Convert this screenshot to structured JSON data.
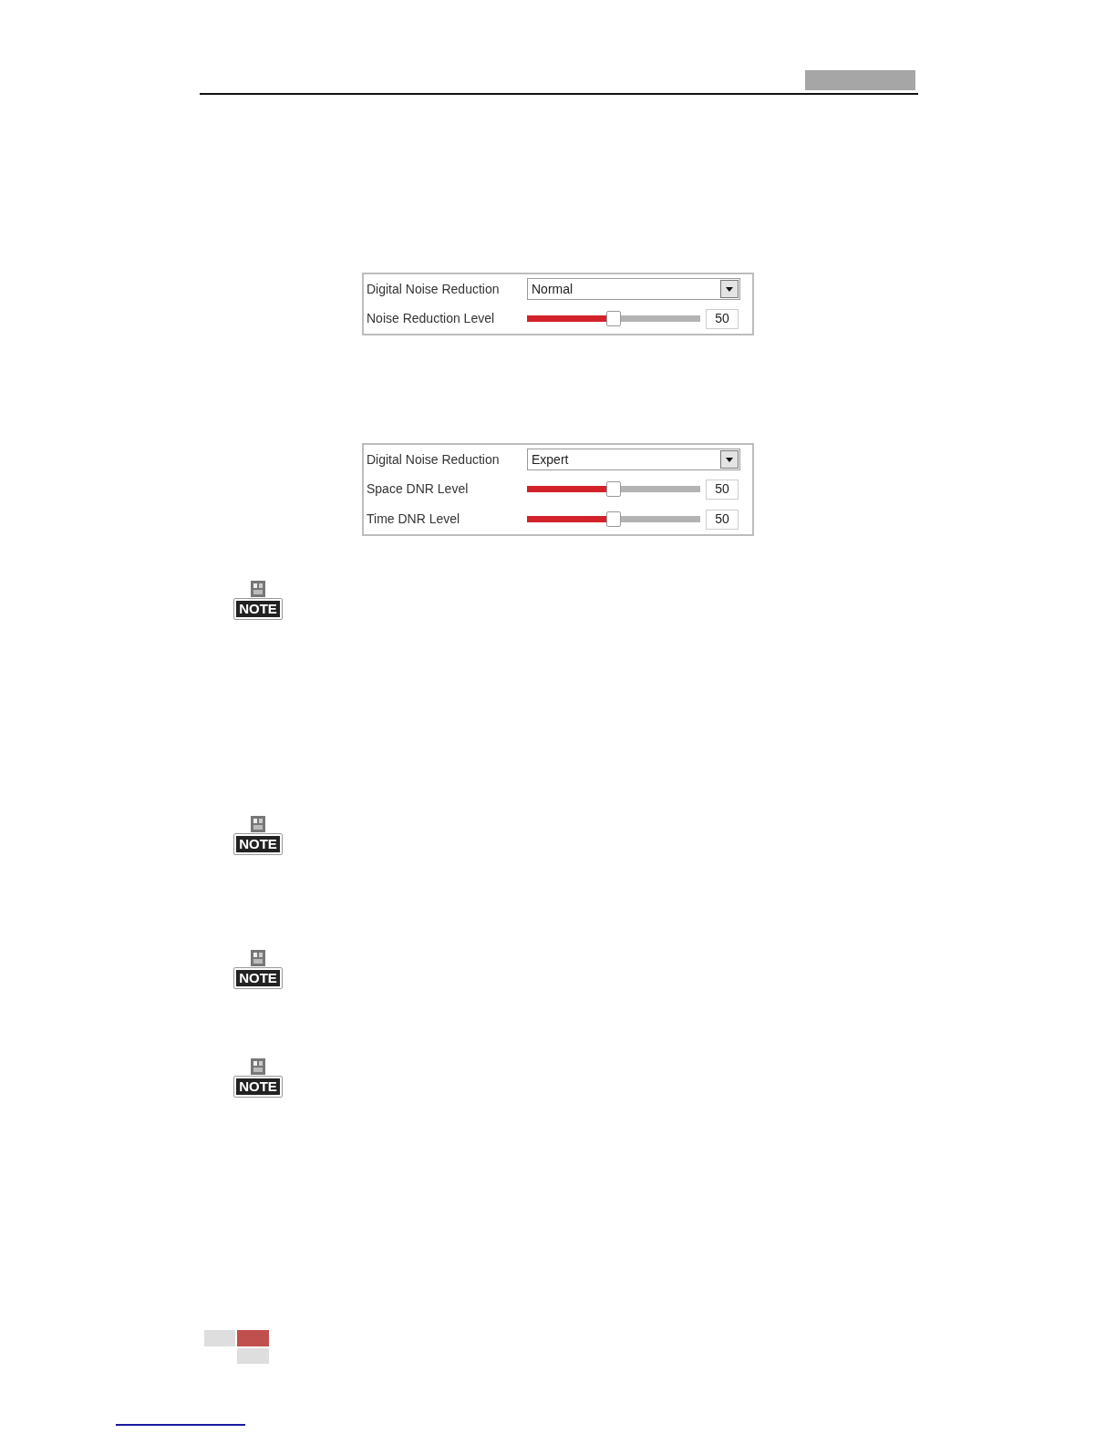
{
  "panels": [
    {
      "rows": [
        {
          "kind": "select",
          "label": "Digital Noise Reduction",
          "value": "Normal"
        },
        {
          "kind": "slider",
          "label": "Noise Reduction Level",
          "level": 0.5,
          "value": "50"
        }
      ]
    },
    {
      "rows": [
        {
          "kind": "select",
          "label": "Digital Noise Reduction",
          "value": "Expert"
        },
        {
          "kind": "slider",
          "label": "Space DNR Level",
          "level": 0.5,
          "value": "50"
        },
        {
          "kind": "slider",
          "label": "Time DNR Level",
          "level": 0.5,
          "value": "50"
        }
      ]
    }
  ],
  "notes": [
    {
      "label": "NOTE"
    },
    {
      "label": "NOTE"
    },
    {
      "label": "NOTE"
    },
    {
      "label": "NOTE"
    }
  ]
}
